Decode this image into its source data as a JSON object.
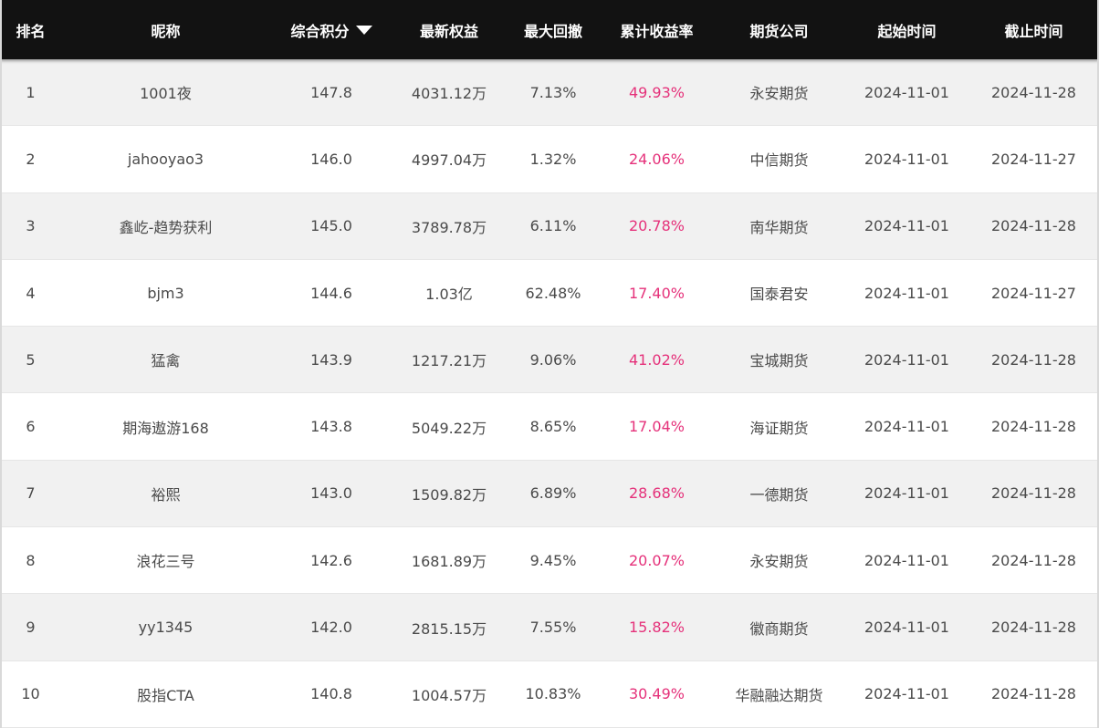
{
  "header": {
    "rank": "排名",
    "nickname": "昵称",
    "score": "综合积分",
    "equity": "最新权益",
    "drawdown": "最大回撤",
    "return": "累计收益率",
    "broker": "期货公司",
    "start": "起始时间",
    "end": "截止时间"
  },
  "sort": {
    "column": "综合积分",
    "direction": "descending",
    "icon": "sort-down-triangle-icon"
  },
  "colors": {
    "header_bg": "#121212",
    "return_text": "#e5317a",
    "row_alt": "#f1f1f1"
  },
  "rows": [
    {
      "rank": "1",
      "nickname": "1001夜",
      "score": "147.8",
      "equity": "4031.12万",
      "drawdown": "7.13%",
      "return": "49.93%",
      "broker": "永安期货",
      "start": "2024-11-01",
      "end": "2024-11-28"
    },
    {
      "rank": "2",
      "nickname": "jahooyao3",
      "score": "146.0",
      "equity": "4997.04万",
      "drawdown": "1.32%",
      "return": "24.06%",
      "broker": "中信期货",
      "start": "2024-11-01",
      "end": "2024-11-27"
    },
    {
      "rank": "3",
      "nickname": "鑫屹-趋势获利",
      "score": "145.0",
      "equity": "3789.78万",
      "drawdown": "6.11%",
      "return": "20.78%",
      "broker": "南华期货",
      "start": "2024-11-01",
      "end": "2024-11-28"
    },
    {
      "rank": "4",
      "nickname": "bjm3",
      "score": "144.6",
      "equity": "1.03亿",
      "drawdown": "62.48%",
      "return": "17.40%",
      "broker": "国泰君安",
      "start": "2024-11-01",
      "end": "2024-11-27"
    },
    {
      "rank": "5",
      "nickname": "猛禽",
      "score": "143.9",
      "equity": "1217.21万",
      "drawdown": "9.06%",
      "return": "41.02%",
      "broker": "宝城期货",
      "start": "2024-11-01",
      "end": "2024-11-28"
    },
    {
      "rank": "6",
      "nickname": "期海遨游168",
      "score": "143.8",
      "equity": "5049.22万",
      "drawdown": "8.65%",
      "return": "17.04%",
      "broker": "海证期货",
      "start": "2024-11-01",
      "end": "2024-11-28"
    },
    {
      "rank": "7",
      "nickname": "裕熙",
      "score": "143.0",
      "equity": "1509.82万",
      "drawdown": "6.89%",
      "return": "28.68%",
      "broker": "一德期货",
      "start": "2024-11-01",
      "end": "2024-11-28"
    },
    {
      "rank": "8",
      "nickname": "浪花三号",
      "score": "142.6",
      "equity": "1681.89万",
      "drawdown": "9.45%",
      "return": "20.07%",
      "broker": "永安期货",
      "start": "2024-11-01",
      "end": "2024-11-28"
    },
    {
      "rank": "9",
      "nickname": "yy1345",
      "score": "142.0",
      "equity": "2815.15万",
      "drawdown": "7.55%",
      "return": "15.82%",
      "broker": "徽商期货",
      "start": "2024-11-01",
      "end": "2024-11-28"
    },
    {
      "rank": "10",
      "nickname": "股指CTA",
      "score": "140.8",
      "equity": "1004.57万",
      "drawdown": "10.83%",
      "return": "30.49%",
      "broker": "华融融达期货",
      "start": "2024-11-01",
      "end": "2024-11-28"
    }
  ]
}
